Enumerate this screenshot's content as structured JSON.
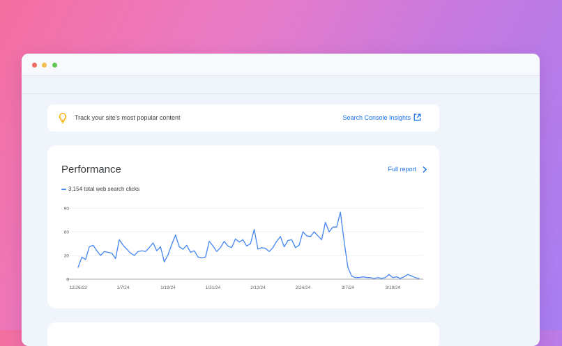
{
  "tip": {
    "text": "Track your site's most popular content",
    "link_label": "Search Console Insights",
    "icon": "lightbulb-icon"
  },
  "performance": {
    "title": "Performance",
    "full_report_label": "Full report",
    "legend_label": "3,154 total web search clicks"
  },
  "colors": {
    "accent": "#1a73e8",
    "series": "#4285f4",
    "tip_icon": "#f9ab00"
  },
  "chart_data": {
    "type": "line",
    "ylim": [
      0,
      90
    ],
    "yticks": [
      "0",
      "30",
      "60",
      "90"
    ],
    "xticks": [
      {
        "label": "12/26/23",
        "index": 0
      },
      {
        "label": "1/7/24",
        "index": 12
      },
      {
        "label": "1/19/24",
        "index": 24
      },
      {
        "label": "1/31/24",
        "index": 36
      },
      {
        "label": "2/12/24",
        "index": 48
      },
      {
        "label": "2/24/24",
        "index": 60
      },
      {
        "label": "3/7/24",
        "index": 72
      },
      {
        "label": "3/19/24",
        "index": 84
      }
    ],
    "grid": true,
    "series": [
      {
        "name": "Clicks",
        "values": [
          15,
          28,
          25,
          41,
          43,
          36,
          30,
          35,
          34,
          33,
          26,
          50,
          43,
          38,
          33,
          30,
          35,
          36,
          35,
          40,
          46,
          36,
          41,
          22,
          31,
          44,
          56,
          41,
          38,
          43,
          34,
          36,
          28,
          27,
          28,
          48,
          42,
          35,
          40,
          48,
          42,
          40,
          51,
          47,
          50,
          42,
          45,
          63,
          38,
          40,
          39,
          35,
          40,
          48,
          54,
          41,
          49,
          50,
          40,
          43,
          60,
          55,
          54,
          60,
          55,
          50,
          72,
          60,
          66,
          66,
          85,
          48,
          15,
          4,
          2,
          2,
          3,
          2,
          2,
          1,
          2,
          1,
          2,
          6,
          2,
          3,
          1,
          3,
          6,
          4,
          2,
          1
        ]
      }
    ]
  }
}
